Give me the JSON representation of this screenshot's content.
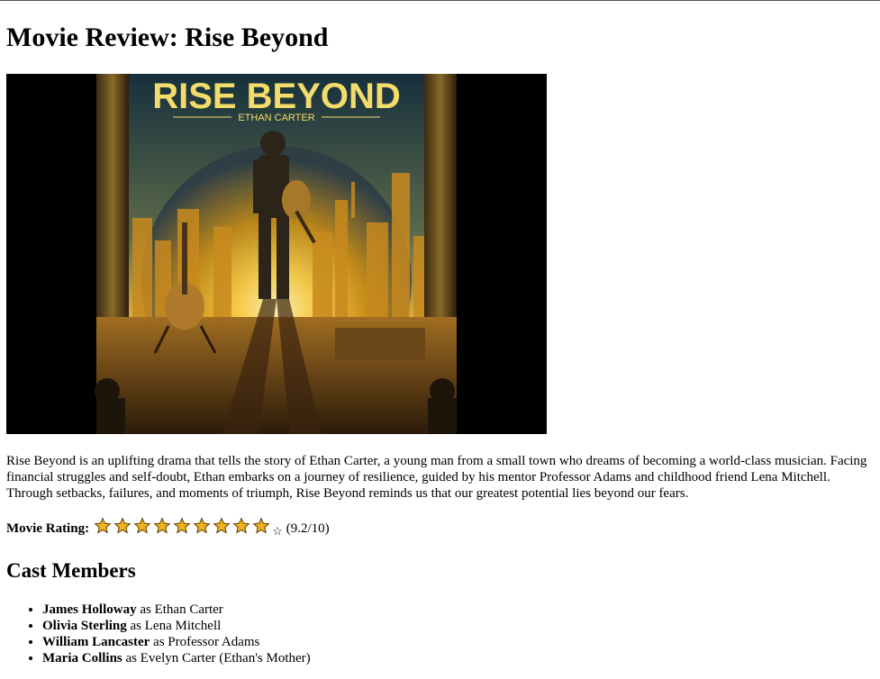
{
  "page": {
    "title": "Movie Review: Rise Beyond"
  },
  "poster": {
    "title_text": "RISE BEYOND",
    "subtitle_text": "ETHAN CARTER"
  },
  "description": "Rise Beyond is an uplifting drama that tells the story of Ethan Carter, a young man from a small town who dreams of becoming a world-class musician. Facing financial struggles and self-doubt, Ethan embarks on a journey of resilience, guided by his mentor Professor Adams and childhood friend Lena Mitchell. Through setbacks, failures, and moments of triumph, Rise Beyond reminds us that our greatest potential lies beyond our fears.",
  "rating": {
    "label": "Movie Rating:",
    "filled_stars": 9,
    "total_stars": 10,
    "empty_star_glyph": "☆",
    "score_text": "(9.2/10)",
    "star_color": "#f2b21f"
  },
  "cast": {
    "heading": "Cast Members",
    "members": [
      {
        "actor": "James Holloway",
        "connector": " as ",
        "role": "Ethan Carter"
      },
      {
        "actor": "Olivia Sterling",
        "connector": " as ",
        "role": "Lena Mitchell"
      },
      {
        "actor": "William Lancaster",
        "connector": " as ",
        "role": "Professor Adams"
      },
      {
        "actor": "Maria Collins",
        "connector": " as ",
        "role": "Evelyn Carter (Ethan's Mother)"
      }
    ]
  }
}
